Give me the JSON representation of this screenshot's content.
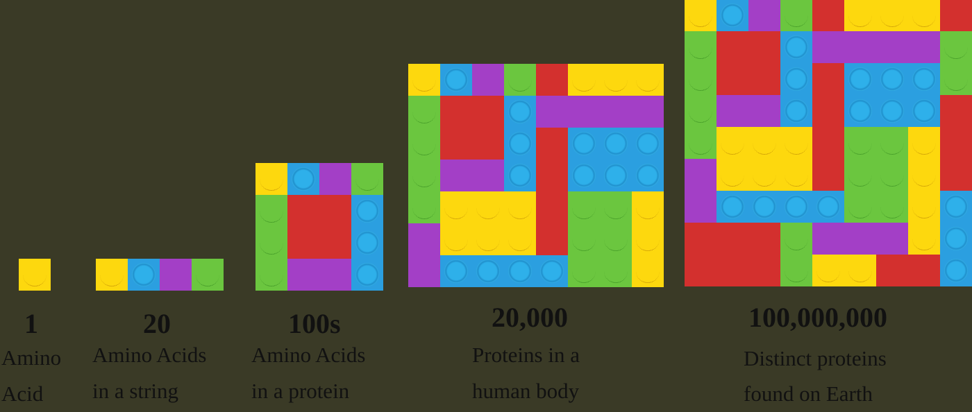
{
  "colors": {
    "background": "#3a3a26",
    "yellow": "#fdd80e",
    "blue": "#2b9fe0",
    "purple": "#a33fc6",
    "green": "#6bc63f",
    "red": "#d3302e"
  },
  "stages": [
    {
      "count": "1",
      "desc_line1": "Amino",
      "desc_line2": "Acid"
    },
    {
      "count": "20",
      "desc_line1": "Amino Acids",
      "desc_line2": "in a string"
    },
    {
      "count": "100s",
      "desc_line1": "Amino Acids",
      "desc_line2": "in a protein"
    },
    {
      "count": "20,000",
      "desc_line1": "Proteins in a",
      "desc_line2": "human body"
    },
    {
      "count": "100,000,000",
      "desc_line1": "Distinct proteins",
      "desc_line2": "found on Earth"
    }
  ]
}
